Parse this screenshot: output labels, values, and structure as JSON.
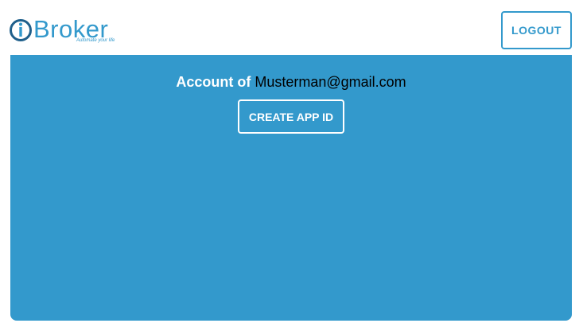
{
  "header": {
    "logo_text": "Broker",
    "logo_tagline": "Automate your life",
    "logout_label": "LOGOUT"
  },
  "account": {
    "label": "Account of",
    "email": "Musterman@gmail.com",
    "create_app_id_label": "CREATE APP ID"
  },
  "colors": {
    "brand": "#3399cc",
    "text_on_brand": "#ffffff"
  }
}
